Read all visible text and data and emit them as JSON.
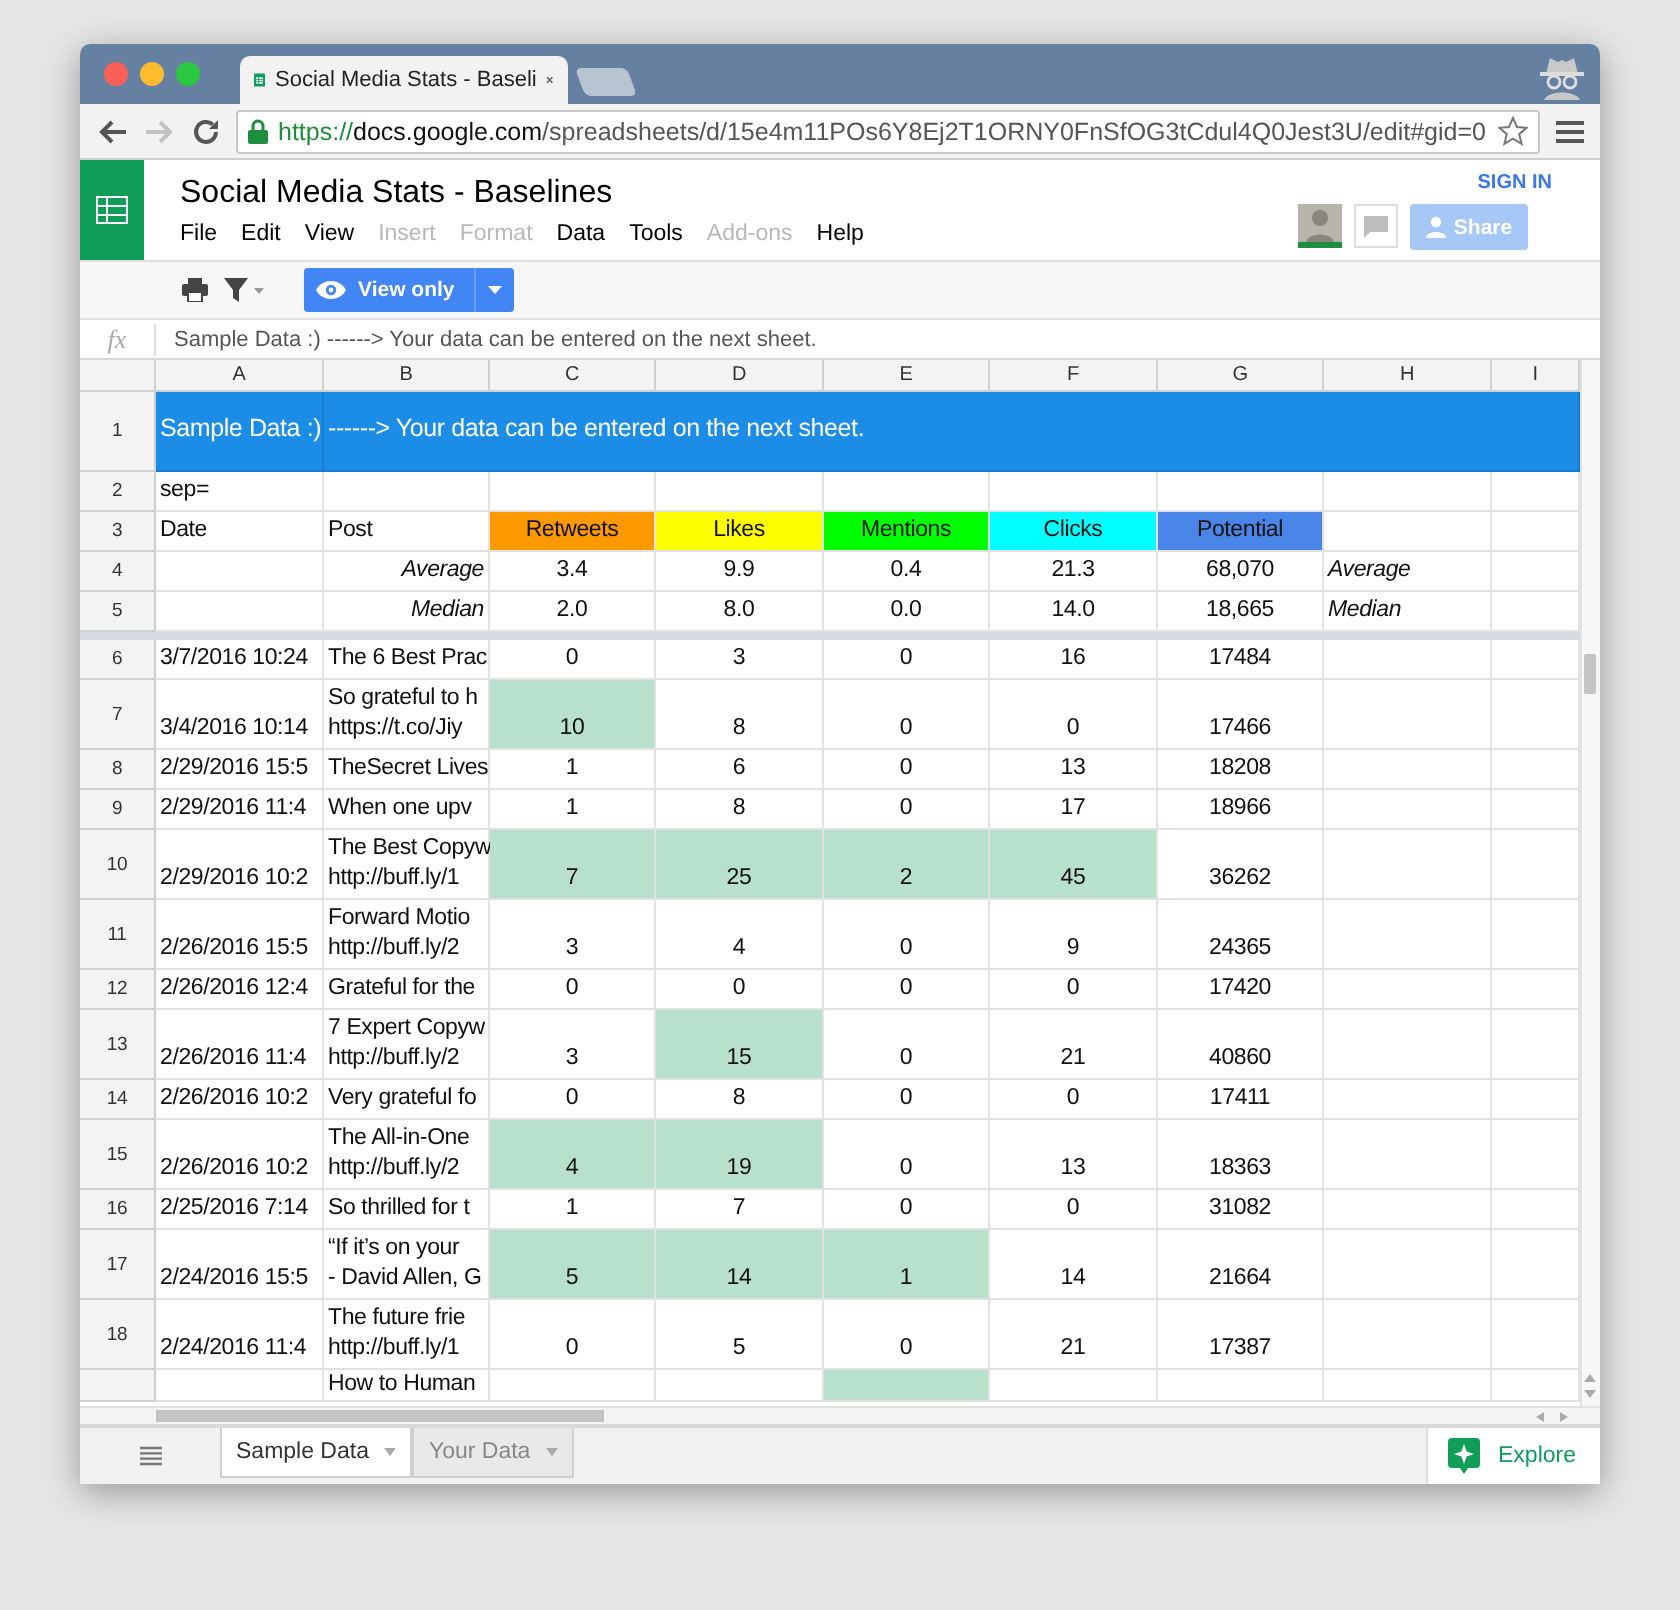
{
  "browser": {
    "tab_title": "Social Media Stats - Baseli",
    "url_scheme": "https://",
    "url_host": "docs.google.com",
    "url_path": "/spreadsheets/d/15e4m11POs6Y8Ej2T1ORNY0FnSfOG3tCdul4Q0Jest3U/edit#gid=0"
  },
  "doc": {
    "title": "Social Media Stats - Baselines",
    "menu": [
      {
        "label": "File",
        "disabled": false
      },
      {
        "label": "Edit",
        "disabled": false
      },
      {
        "label": "View",
        "disabled": false
      },
      {
        "label": "Insert",
        "disabled": true
      },
      {
        "label": "Format",
        "disabled": true
      },
      {
        "label": "Data",
        "disabled": false
      },
      {
        "label": "Tools",
        "disabled": false
      },
      {
        "label": "Add-ons",
        "disabled": true
      },
      {
        "label": "Help",
        "disabled": false
      }
    ],
    "sign_in": "SIGN IN",
    "share": {
      "label": "Share",
      "disabled": true
    },
    "view_mode": "View only"
  },
  "formula_bar": {
    "fx": "fx",
    "value": "Sample Data :) ------> Your data can be entered on the next sheet."
  },
  "sheet": {
    "columns": [
      "A",
      "B",
      "C",
      "D",
      "E",
      "F",
      "G",
      "H",
      "I"
    ],
    "frozen_rows": [
      {
        "number": "1",
        "kind": "banner",
        "cells": [
          {
            "kind": "banner",
            "text": "Sample Data :)",
            "color": "#1c8de6"
          },
          {
            "kind": "banner",
            "text": "------> Your data can be entered on the next sheet.",
            "color": "#1c8de6"
          }
        ]
      },
      {
        "number": "2",
        "kind": "normal",
        "cells": [
          {
            "kind": "text",
            "text": "sep="
          },
          null,
          null,
          null,
          null,
          null,
          null,
          null
        ]
      },
      {
        "number": "3",
        "kind": "normal",
        "cells": [
          {
            "kind": "text",
            "text": "Date"
          },
          {
            "kind": "text",
            "text": "Post"
          },
          {
            "kind": "header",
            "text": "Retweets",
            "color": "#ff9900"
          },
          {
            "kind": "header",
            "text": "Likes",
            "color": "#ffff00"
          },
          {
            "kind": "header",
            "text": "Mentions",
            "color": "#00ff00"
          },
          {
            "kind": "header",
            "text": "Clicks",
            "color": "#00ffff"
          },
          {
            "kind": "header",
            "text": "Potential",
            "color": "#4a86e8"
          },
          null
        ]
      },
      {
        "number": "4",
        "kind": "normal",
        "cells": [
          null,
          {
            "kind": "label",
            "text": "Average"
          },
          {
            "kind": "number",
            "text": "3.4",
            "highlighted": false
          },
          {
            "kind": "number",
            "text": "9.9",
            "highlighted": false
          },
          {
            "kind": "number",
            "text": "0.4",
            "highlighted": false
          },
          {
            "kind": "number",
            "text": "21.3",
            "highlighted": false
          },
          {
            "kind": "number",
            "text": "68,070",
            "highlighted": false
          },
          {
            "kind": "label",
            "text": "Average"
          }
        ]
      },
      {
        "number": "5",
        "kind": "normal",
        "cells": [
          null,
          {
            "kind": "label",
            "text": "Median"
          },
          {
            "kind": "number",
            "text": "2.0",
            "highlighted": false
          },
          {
            "kind": "number",
            "text": "8.0",
            "highlighted": false
          },
          {
            "kind": "number",
            "text": "0.0",
            "highlighted": false
          },
          {
            "kind": "number",
            "text": "14.0",
            "highlighted": false
          },
          {
            "kind": "number",
            "text": "18,665",
            "highlighted": false
          },
          {
            "kind": "label",
            "text": "Median"
          }
        ]
      }
    ],
    "rows": [
      {
        "number": "6",
        "kind": "normal",
        "cells": [
          {
            "kind": "text",
            "text": "3/7/2016 10:24"
          },
          {
            "kind": "text",
            "lines": [
              "The 6 Best Prac"
            ]
          },
          {
            "kind": "number",
            "text": "0",
            "highlighted": false
          },
          {
            "kind": "number",
            "text": "3",
            "highlighted": false
          },
          {
            "kind": "number",
            "text": "0",
            "highlighted": false
          },
          {
            "kind": "number",
            "text": "16",
            "highlighted": false
          },
          {
            "kind": "number",
            "text": "17484",
            "highlighted": false
          },
          null
        ]
      },
      {
        "number": "7",
        "kind": "normal",
        "cells": [
          {
            "kind": "text",
            "text": "3/4/2016 10:14"
          },
          {
            "kind": "text",
            "lines": [
              "So grateful to h",
              "https://t.co/Jiy"
            ]
          },
          {
            "kind": "number",
            "text": "10",
            "highlighted": true
          },
          {
            "kind": "number",
            "text": "8",
            "highlighted": false
          },
          {
            "kind": "number",
            "text": "0",
            "highlighted": false
          },
          {
            "kind": "number",
            "text": "0",
            "highlighted": false
          },
          {
            "kind": "number",
            "text": "17466",
            "highlighted": false
          },
          null
        ]
      },
      {
        "number": "8",
        "kind": "normal",
        "cells": [
          {
            "kind": "text",
            "text": "2/29/2016 15:5"
          },
          {
            "kind": "text",
            "lines": [
              "TheSecret Lives"
            ]
          },
          {
            "kind": "number",
            "text": "1",
            "highlighted": false
          },
          {
            "kind": "number",
            "text": "6",
            "highlighted": false
          },
          {
            "kind": "number",
            "text": "0",
            "highlighted": false
          },
          {
            "kind": "number",
            "text": "13",
            "highlighted": false
          },
          {
            "kind": "number",
            "text": "18208",
            "highlighted": false
          },
          null
        ]
      },
      {
        "number": "9",
        "kind": "normal",
        "cells": [
          {
            "kind": "text",
            "text": "2/29/2016 11:4"
          },
          {
            "kind": "text",
            "lines": [
              "When one upv"
            ]
          },
          {
            "kind": "number",
            "text": "1",
            "highlighted": false
          },
          {
            "kind": "number",
            "text": "8",
            "highlighted": false
          },
          {
            "kind": "number",
            "text": "0",
            "highlighted": false
          },
          {
            "kind": "number",
            "text": "17",
            "highlighted": false
          },
          {
            "kind": "number",
            "text": "18966",
            "highlighted": false
          },
          null
        ]
      },
      {
        "number": "10",
        "kind": "normal",
        "cells": [
          {
            "kind": "text",
            "text": "2/29/2016 10:2"
          },
          {
            "kind": "text",
            "lines": [
              "The Best Copyw",
              "http://buff.ly/1"
            ]
          },
          {
            "kind": "number",
            "text": "7",
            "highlighted": true
          },
          {
            "kind": "number",
            "text": "25",
            "highlighted": true
          },
          {
            "kind": "number",
            "text": "2",
            "highlighted": true
          },
          {
            "kind": "number",
            "text": "45",
            "highlighted": true
          },
          {
            "kind": "number",
            "text": "36262",
            "highlighted": false
          },
          null
        ]
      },
      {
        "number": "11",
        "kind": "normal",
        "cells": [
          {
            "kind": "text",
            "text": "2/26/2016 15:5"
          },
          {
            "kind": "text",
            "lines": [
              "Forward Motio",
              "http://buff.ly/2"
            ]
          },
          {
            "kind": "number",
            "text": "3",
            "highlighted": false
          },
          {
            "kind": "number",
            "text": "4",
            "highlighted": false
          },
          {
            "kind": "number",
            "text": "0",
            "highlighted": false
          },
          {
            "kind": "number",
            "text": "9",
            "highlighted": false
          },
          {
            "kind": "number",
            "text": "24365",
            "highlighted": false
          },
          null
        ]
      },
      {
        "number": "12",
        "kind": "normal",
        "cells": [
          {
            "kind": "text",
            "text": "2/26/2016 12:4"
          },
          {
            "kind": "text",
            "lines": [
              "Grateful for the"
            ]
          },
          {
            "kind": "number",
            "text": "0",
            "highlighted": false
          },
          {
            "kind": "number",
            "text": "0",
            "highlighted": false
          },
          {
            "kind": "number",
            "text": "0",
            "highlighted": false
          },
          {
            "kind": "number",
            "text": "0",
            "highlighted": false
          },
          {
            "kind": "number",
            "text": "17420",
            "highlighted": false
          },
          null
        ]
      },
      {
        "number": "13",
        "kind": "normal",
        "cells": [
          {
            "kind": "text",
            "text": "2/26/2016 11:4"
          },
          {
            "kind": "text",
            "lines": [
              "7 Expert Copyw",
              "http://buff.ly/2"
            ]
          },
          {
            "kind": "number",
            "text": "3",
            "highlighted": false
          },
          {
            "kind": "number",
            "text": "15",
            "highlighted": true
          },
          {
            "kind": "number",
            "text": "0",
            "highlighted": false
          },
          {
            "kind": "number",
            "text": "21",
            "highlighted": false
          },
          {
            "kind": "number",
            "text": "40860",
            "highlighted": false
          },
          null
        ]
      },
      {
        "number": "14",
        "kind": "normal",
        "cells": [
          {
            "kind": "text",
            "text": "2/26/2016 10:2"
          },
          {
            "kind": "text",
            "lines": [
              "Very grateful fo"
            ]
          },
          {
            "kind": "number",
            "text": "0",
            "highlighted": false
          },
          {
            "kind": "number",
            "text": "8",
            "highlighted": false
          },
          {
            "kind": "number",
            "text": "0",
            "highlighted": false
          },
          {
            "kind": "number",
            "text": "0",
            "highlighted": false
          },
          {
            "kind": "number",
            "text": "17411",
            "highlighted": false
          },
          null
        ]
      },
      {
        "number": "15",
        "kind": "normal",
        "cells": [
          {
            "kind": "text",
            "text": "2/26/2016 10:2"
          },
          {
            "kind": "text",
            "lines": [
              "The All-in-One",
              "http://buff.ly/2"
            ]
          },
          {
            "kind": "number",
            "text": "4",
            "highlighted": true
          },
          {
            "kind": "number",
            "text": "19",
            "highlighted": true
          },
          {
            "kind": "number",
            "text": "0",
            "highlighted": false
          },
          {
            "kind": "number",
            "text": "13",
            "highlighted": false
          },
          {
            "kind": "number",
            "text": "18363",
            "highlighted": false
          },
          null
        ]
      },
      {
        "number": "16",
        "kind": "normal",
        "cells": [
          {
            "kind": "text",
            "text": "2/25/2016 7:14"
          },
          {
            "kind": "text",
            "lines": [
              "So thrilled for t"
            ]
          },
          {
            "kind": "number",
            "text": "1",
            "highlighted": false
          },
          {
            "kind": "number",
            "text": "7",
            "highlighted": false
          },
          {
            "kind": "number",
            "text": "0",
            "highlighted": false
          },
          {
            "kind": "number",
            "text": "0",
            "highlighted": false
          },
          {
            "kind": "number",
            "text": "31082",
            "highlighted": false
          },
          null
        ]
      },
      {
        "number": "17",
        "kind": "normal",
        "cells": [
          {
            "kind": "text",
            "text": "2/24/2016 15:5"
          },
          {
            "kind": "text",
            "lines": [
              "“If it’s on your",
              "- David Allen, G"
            ]
          },
          {
            "kind": "number",
            "text": "5",
            "highlighted": true
          },
          {
            "kind": "number",
            "text": "14",
            "highlighted": true
          },
          {
            "kind": "number",
            "text": "1",
            "highlighted": true
          },
          {
            "kind": "number",
            "text": "14",
            "highlighted": false
          },
          {
            "kind": "number",
            "text": "21664",
            "highlighted": false
          },
          null
        ]
      },
      {
        "number": "18",
        "kind": "normal",
        "cells": [
          {
            "kind": "text",
            "text": "2/24/2016 11:4"
          },
          {
            "kind": "text",
            "lines": [
              "The future frie",
              "http://buff.ly/1"
            ]
          },
          {
            "kind": "number",
            "text": "0",
            "highlighted": false
          },
          {
            "kind": "number",
            "text": "5",
            "highlighted": false
          },
          {
            "kind": "number",
            "text": "0",
            "highlighted": false
          },
          {
            "kind": "number",
            "text": "21",
            "highlighted": false
          },
          {
            "kind": "number",
            "text": "17387",
            "highlighted": false
          },
          null
        ]
      },
      {
        "kind": "partial",
        "cells": [
          null,
          {
            "kind": "text",
            "lines": [
              "How to Human"
            ]
          },
          null,
          null,
          {
            "kind": "number",
            "highlighted": true
          },
          null,
          null,
          null
        ]
      }
    ]
  },
  "sheet_tabs": [
    {
      "label": "Sample Data",
      "selected": true
    },
    {
      "label": "Your Data",
      "selected": false
    }
  ],
  "explore": "Explore"
}
